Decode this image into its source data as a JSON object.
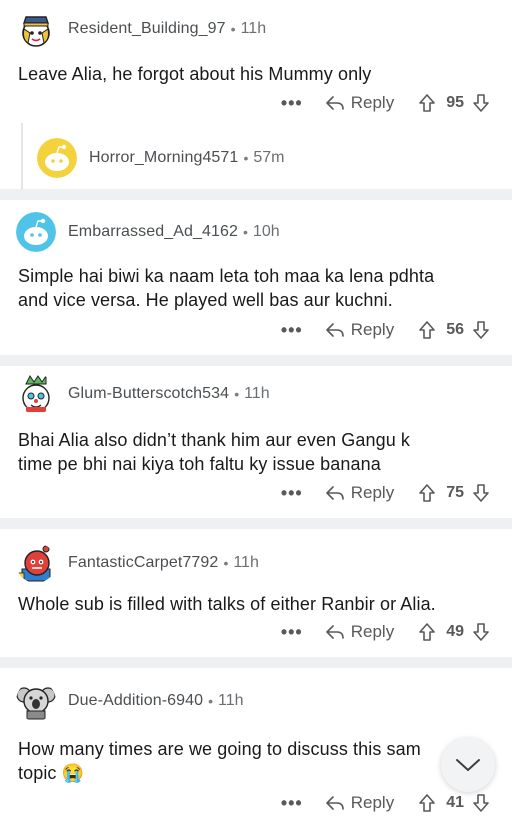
{
  "comments": [
    {
      "username": "Resident_Building_97",
      "time": "11h",
      "lines": [
        "Leave Alia, he forgot about his Mummy only"
      ],
      "reply": "Reply",
      "votes": "95"
    },
    {
      "username": "Horror_Morning4571",
      "time": "57m"
    },
    {
      "username": "Embarrassed_Ad_4162",
      "time": "10h",
      "lines": [
        "Simple hai biwi ka naam leta toh maa ka lena pdhta",
        "and vice versa. He played well bas aur kuchni."
      ],
      "reply": "Reply",
      "votes": "56"
    },
    {
      "username": "Glum-Butterscotch534",
      "time": "11h",
      "lines": [
        "Bhai Alia also didn’t thank him aur even Gangu k",
        "time pe bhi nai kiya toh faltu ky issue banana"
      ],
      "reply": "Reply",
      "votes": "75"
    },
    {
      "username": "FantasticCarpet7792",
      "time": "11h",
      "lines": [
        "Whole sub is filled with talks of either Ranbir or Alia."
      ],
      "reply": "Reply",
      "votes": "49"
    },
    {
      "username": "Due-Addition-6940",
      "time": "11h",
      "lines": [
        "How many times are we going to discuss this sam",
        "topic 😭"
      ],
      "reply": "Reply",
      "votes": "41"
    }
  ],
  "more_label": "•••",
  "separator": "•"
}
